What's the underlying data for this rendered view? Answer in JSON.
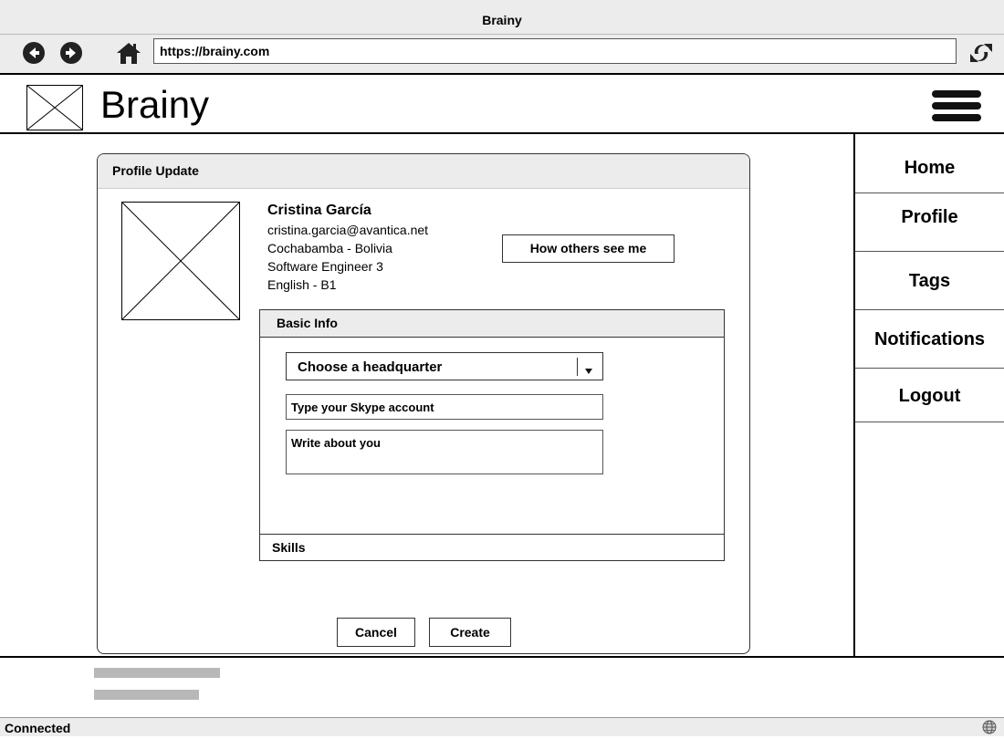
{
  "window": {
    "title": "Brainy"
  },
  "browser": {
    "url": "https://brainy.com",
    "back_icon": "back-arrow-icon",
    "forward_icon": "forward-arrow-icon",
    "home_icon": "home-icon",
    "refresh_icon": "refresh-icon"
  },
  "header": {
    "brand": "Brainy",
    "menu_icon": "hamburger-menu-icon"
  },
  "profile_panel": {
    "title": "Profile Update",
    "user": {
      "name": "Cristina García",
      "email": "cristina.garcia@avantica.net",
      "location": "Cochabamba - Bolivia",
      "role": "Software Engineer 3",
      "language": "English - B1"
    },
    "how_others_button": "How others see me",
    "basic_info": {
      "title": "Basic Info",
      "headquarter_select": "Choose a headquarter",
      "skype_placeholder": "Type your Skype account",
      "about_placeholder": "Write about you"
    },
    "skills_label": "Skills",
    "cancel_label": "Cancel",
    "create_label": "Create"
  },
  "sidenav": {
    "items": [
      {
        "label": "Home"
      },
      {
        "label": "Profile"
      },
      {
        "label": "Tags"
      },
      {
        "label": "Notifications"
      },
      {
        "label": "Logout"
      }
    ]
  },
  "status_bar": {
    "text": "Connected",
    "icon": "globe-icon"
  }
}
